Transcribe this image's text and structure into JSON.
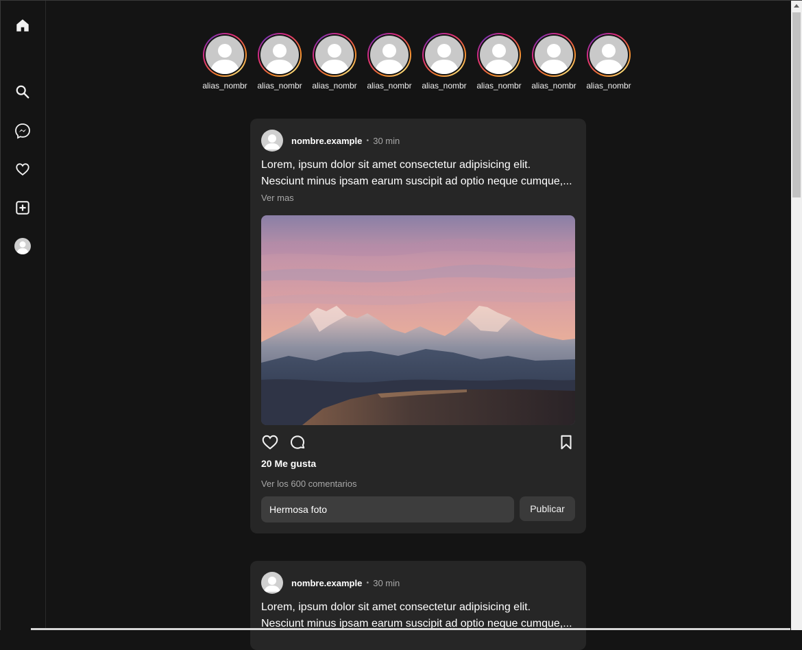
{
  "sidebar": {
    "items": [
      {
        "name": "home-icon"
      },
      {
        "name": "search-icon"
      },
      {
        "name": "messenger-icon"
      },
      {
        "name": "heart-icon"
      },
      {
        "name": "add-post-icon"
      },
      {
        "name": "profile-avatar-icon"
      }
    ]
  },
  "stories": [
    {
      "username": "alias_nombr"
    },
    {
      "username": "alias_nombr"
    },
    {
      "username": "alias_nombr"
    },
    {
      "username": "alias_nombr"
    },
    {
      "username": "alias_nombr"
    },
    {
      "username": "alias_nombr"
    },
    {
      "username": "alias_nombr"
    },
    {
      "username": "alias_nombr"
    }
  ],
  "posts": [
    {
      "username": "nombre.example",
      "separator": "•",
      "time": "30 min",
      "caption_line1": "Lorem, ipsum dolor sit amet consectetur adipisicing elit.",
      "caption_line2": "Nesciunt minus ipsam earum suscipit ad optio neque cumque,...",
      "see_more": "Ver mas",
      "likes": "20 Me gusta",
      "comments_link": "Ver los 600 comentarios",
      "comment_value": "Hermosa foto",
      "publish_label": "Publicar"
    },
    {
      "username": "nombre.example",
      "separator": "•",
      "time": "30 min",
      "caption_line1": "Lorem, ipsum dolor sit amet consectetur adipisicing elit.",
      "caption_line2": "Nesciunt minus ipsam earum suscipit ad optio neque cumque,..."
    }
  ],
  "colors": {
    "background": "#141414",
    "card": "#262626",
    "story_ring": "#dd2a7b"
  }
}
